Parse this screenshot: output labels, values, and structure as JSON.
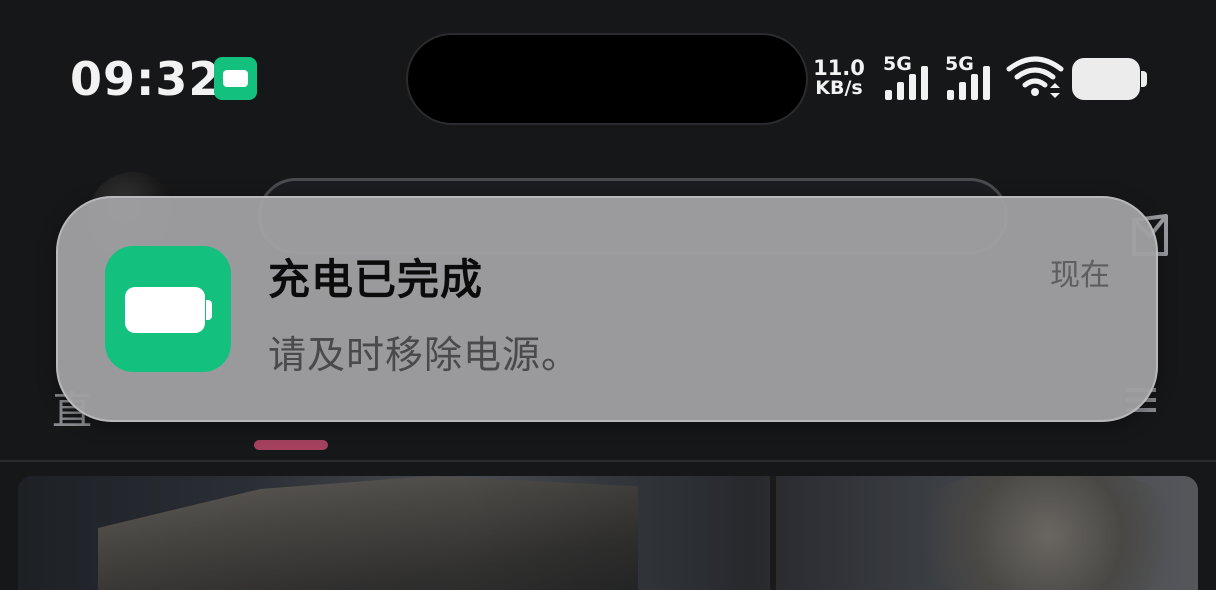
{
  "status_bar": {
    "time": "09:32",
    "network_speed_value": "11.0",
    "network_speed_unit": "KB/s",
    "sim1_label": "5G",
    "sim2_label": "5G",
    "charging_indicator_icon": "battery-icon",
    "wifi_icon": "wifi-icon",
    "battery_icon": "battery-icon",
    "battery_level_fraction": 1.0
  },
  "notification": {
    "app_icon": "battery-icon",
    "app_icon_color": "#13c07e",
    "title": "充电已完成",
    "body": "请及时移除电源。",
    "time": "现在"
  },
  "background_app": {
    "visible_tab_fragment": "直",
    "active_tab_indicator_color": "#a3415f",
    "mail_icon": "mail-icon",
    "menu_icon": "menu-icon"
  }
}
